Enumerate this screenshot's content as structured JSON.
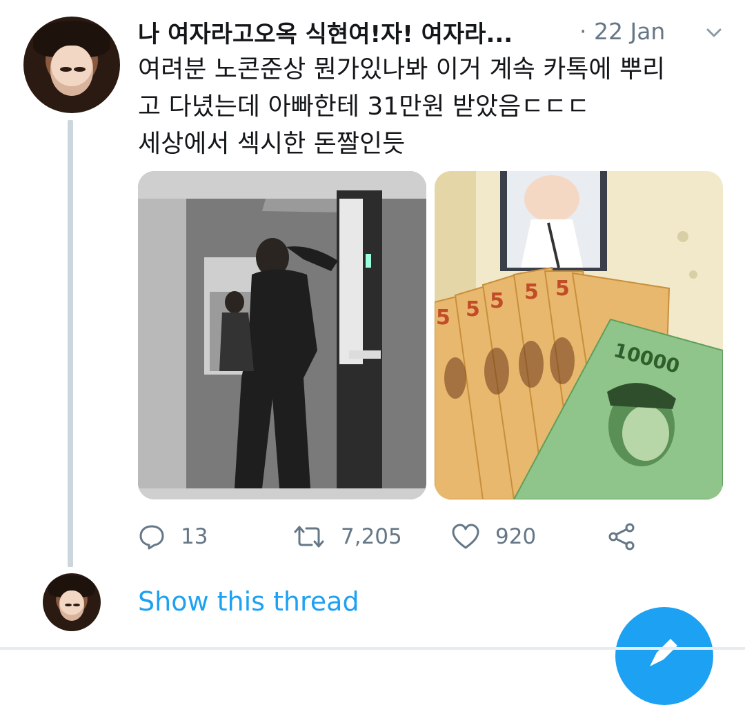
{
  "tweet": {
    "author_name": "나 여자라고오옥 식현여!자! 여자라...",
    "timestamp": "· 22 Jan",
    "text_lines": [
      "여려분 노콘준상 뭔가있나봐 이거 계속 카톡에 뿌리",
      "고 다녔는데 아빠한테 31만원 받았음ㄷㄷㄷ",
      "세상에서 섹시한 돈짤인듯"
    ],
    "media": [
      {
        "icon": "photo-shower-man"
      },
      {
        "icon": "photo-korean-banknotes"
      }
    ],
    "actions": {
      "reply_count": "13",
      "retweet_count": "7,205",
      "like_count": "920"
    }
  },
  "thread": {
    "show_label": "Show this thread"
  },
  "colors": {
    "accent": "#1da1f2",
    "secondary_text": "#657786",
    "thread_line": "#ccd6dd"
  },
  "icons": [
    "chevron-down-icon",
    "reply-icon",
    "retweet-icon",
    "like-icon",
    "share-icon",
    "compose-icon"
  ]
}
